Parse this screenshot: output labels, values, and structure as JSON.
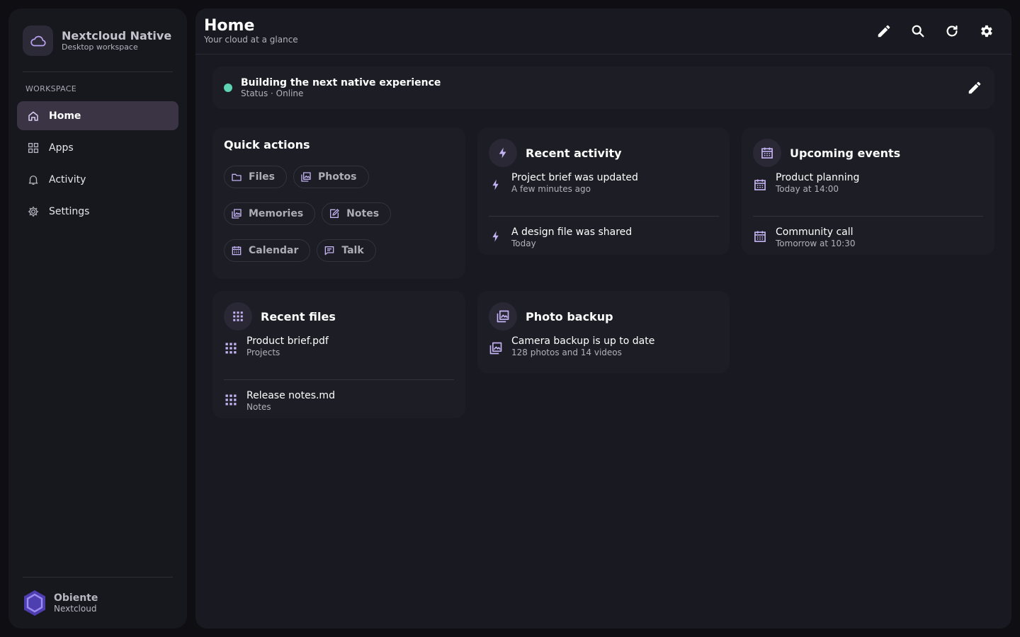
{
  "app": {
    "name": "Nextcloud Native",
    "subtitle": "Desktop workspace",
    "logo_icon": "cloud-icon"
  },
  "sidebar": {
    "section_label": "WORKSPACE",
    "items": [
      {
        "label": "Home",
        "icon": "home-icon",
        "active": true
      },
      {
        "label": "Apps",
        "icon": "grid-icon",
        "active": false
      },
      {
        "label": "Activity",
        "icon": "bell-icon",
        "active": false
      },
      {
        "label": "Settings",
        "icon": "gear-icon",
        "active": false
      }
    ],
    "user": {
      "name": "Obiente",
      "account": "Nextcloud",
      "avatar_icon": "hexagon-logo-icon"
    }
  },
  "header": {
    "title": "Home",
    "subtitle": "Your cloud at a glance",
    "toolbar": [
      "edit-icon",
      "search-icon",
      "refresh-icon",
      "settings-icon"
    ]
  },
  "status": {
    "title": "Building the next native experience",
    "subtitle": "Status · Online",
    "dot_color": "#5fd4b4"
  },
  "quick_actions": {
    "title": "Quick actions",
    "items": [
      {
        "label": "Files",
        "icon": "folder-icon"
      },
      {
        "label": "Photos",
        "icon": "image-icon"
      },
      {
        "label": "Memories",
        "icon": "image-icon"
      },
      {
        "label": "Notes",
        "icon": "note-icon"
      },
      {
        "label": "Calendar",
        "icon": "calendar-icon"
      },
      {
        "label": "Talk",
        "icon": "chat-icon"
      }
    ]
  },
  "recent_activity": {
    "title": "Recent activity",
    "items": [
      {
        "title": "Project brief was updated",
        "sub": "A few minutes ago"
      },
      {
        "title": "A design file was shared",
        "sub": "Today"
      }
    ]
  },
  "upcoming_events": {
    "title": "Upcoming events",
    "items": [
      {
        "title": "Product planning",
        "sub": "Today at 14:00"
      },
      {
        "title": "Community call",
        "sub": "Tomorrow at 10:30"
      }
    ]
  },
  "recent_files": {
    "title": "Recent files",
    "items": [
      {
        "title": "Product brief.pdf",
        "sub": "Projects"
      },
      {
        "title": "Release notes.md",
        "sub": "Notes"
      }
    ]
  },
  "photo_backup": {
    "title": "Photo backup",
    "items": [
      {
        "title": "Camera backup is up to date",
        "sub": "128 photos and 14 videos"
      }
    ]
  },
  "colors": {
    "accent": "#b9a2f0",
    "background": "#0f0f13",
    "sidebar": "#17171e",
    "main": "#191921",
    "card": "#1d1d26",
    "nav_active": "#3a3445"
  }
}
